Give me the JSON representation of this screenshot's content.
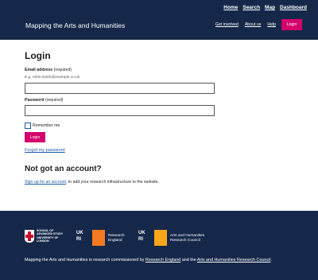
{
  "header": {
    "top_nav": [
      "Home",
      "Search",
      "Map",
      "Dashboard"
    ],
    "site_title": "Mapping the Arts and Humanities",
    "sub_nav": [
      "Get involved",
      "About us",
      "Help"
    ],
    "login_button": "Login"
  },
  "login": {
    "title": "Login",
    "email_label": "Email address",
    "email_required": "(required)",
    "email_hint": "E.g. robin.smith@example.co.uk",
    "email_value": "",
    "password_label": "Password",
    "password_required": "(required)",
    "password_value": "",
    "remember_label": "Remember me",
    "submit_label": "Login",
    "forgot_link": "Forgot my password"
  },
  "signup": {
    "title": "Not got an account?",
    "link_text": "Sign up for an account",
    "rest_text": ", to add your research infrastructure to the website."
  },
  "footer": {
    "sas_logo_text": "SCHOOL OF ADVANCED STUDY UNIVERSITY OF LONDON",
    "ukri_mark_line1": "UK",
    "ukri_mark_line2": "RI",
    "research_england_text": "Research England",
    "ahrc_text": "Arts and Humanities Research Council",
    "text_prefix": "Mapping the Arts and Humanities is research commissioned by ",
    "link_re": "Research England",
    "text_and": " and the ",
    "link_ahrc": "Arts and Humanities Research Council",
    "text_suffix": ".",
    "colors": {
      "header_bg": "#16284a",
      "accent": "#d4006b",
      "link": "#1a5aa7",
      "re_orange": "#f47920",
      "ahrc_orange": "#f9a61a"
    }
  }
}
